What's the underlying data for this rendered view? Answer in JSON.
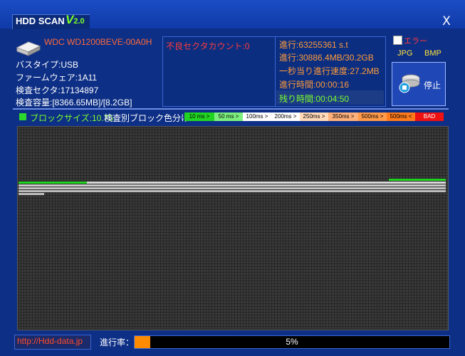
{
  "app": {
    "title": "HDD SCAN",
    "version": "V",
    "version_num": "2.0"
  },
  "window": {
    "close_label": "X"
  },
  "drive": {
    "model": "WDC WD1200BEVE-00A0H",
    "bus_type": "バスタイプ:USB",
    "firmware": "ファームウェア:1A11",
    "sectors": "検査セクタ:17134897",
    "capacity": "検査容量:[8366.65MB]/[8.2GB]"
  },
  "status": {
    "bad_sector_count": "不良セクタカウント:0",
    "progress_sectors": "進行:63255361 s.t",
    "progress_size": "進行:30886.4MB/30.2GB",
    "speed": "一秒当り進行速度:27.2MB",
    "elapsed": "進行時間:00:00:16",
    "remaining": "残り時間:00:04:50"
  },
  "controls": {
    "error_label": "エラー",
    "error_checked": false,
    "jpg_label": "JPG",
    "bmp_label": "BMP",
    "stop_label": "停止"
  },
  "legend": {
    "block_size": "ブロックサイズ:10.75",
    "title": "検査別ブロック色分け :",
    "items": [
      {
        "label": "10 ms >",
        "color": "#22d422"
      },
      {
        "label": "50 ms >",
        "color": "#7dee7d"
      },
      {
        "label": "100ms >",
        "color": "#ffffff"
      },
      {
        "label": "200ms >",
        "color": "#ffffff"
      },
      {
        "label": "250ms >",
        "color": "#ffd9b8"
      },
      {
        "label": "350ms >",
        "color": "#ffb07a"
      },
      {
        "label": "500ms >",
        "color": "#ff9a4a"
      },
      {
        "label": "500ms <",
        "color": "#ff7a1a"
      },
      {
        "label": "BAD",
        "color": "#ee1111"
      }
    ]
  },
  "footer": {
    "url": "http://Hdd-data.jp",
    "progress_label": "進行率：",
    "progress_percent": 5,
    "progress_text": "5%"
  },
  "colors": {
    "background": "#0d2f86",
    "accent_green": "#7cff2a",
    "accent_orange": "#ff9a3a",
    "accent_red": "#ff3a3a",
    "progress": "#ff8c00"
  }
}
